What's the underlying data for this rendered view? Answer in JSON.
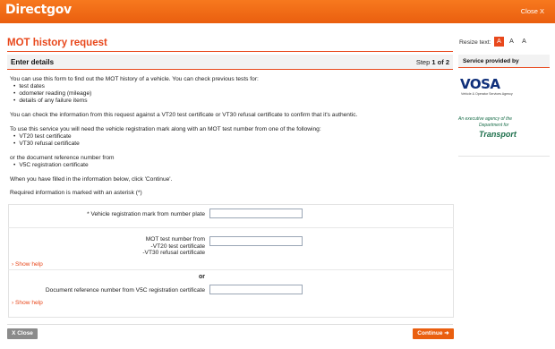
{
  "header": {
    "logo_text": "Directgov",
    "close_label": "Close X"
  },
  "page": {
    "title": "MOT history request",
    "section_title": "Enter details",
    "step_prefix": "Step",
    "step_current": "1",
    "step_of": "of",
    "step_total": "2"
  },
  "intro": {
    "p1": "You can use this form to find out the MOT history of a vehicle. You can check previous tests for:",
    "p1_items": [
      "test dates",
      "odometer reading (mileage)",
      "details of any failure items"
    ],
    "p2": "You can check the information from this request against a VT20 test certificate or VT30 refusal certificate to confirm that it's authentic.",
    "p3": "To use this service you will need the vehicle registration mark along with an MOT test number from one of the following:",
    "p3_items": [
      "VT20 test certificate",
      "VT30 refusal certificate"
    ],
    "p4": "or the document reference number from",
    "p4_items": [
      "V5C registration certificate"
    ],
    "p5": "When you have filled in the information below, click 'Continue'.",
    "p6": "Required information is marked with an asterisk (*)"
  },
  "form": {
    "registration_label": "* Vehicle registration mark from number plate",
    "registration_value": "",
    "mot_label_lines": [
      "MOT test number from",
      "-VT20 test certificate",
      "-VT30 refusal certificate"
    ],
    "mot_value": "",
    "show_help_1": "› Show help",
    "or_label": "or",
    "docref_label": "Document reference number from V5C registration certificate",
    "docref_value": "",
    "show_help_2": "› Show help"
  },
  "buttons": {
    "close": "X Close",
    "continue": "Continue ➜"
  },
  "sidebar": {
    "resize_label": "Resize text:",
    "resize_options": [
      "A",
      "A",
      "A"
    ],
    "provided_by": "Service provided by",
    "vosa_logo": "VOSA",
    "vosa_subtitle": "Vehicle & Operator Services Agency",
    "agency_line1": "An executive agency of the",
    "agency_line2": "Department for",
    "agency_line3": "Transport"
  },
  "colors": {
    "brand_orange": "#ea5f0f",
    "accent_red": "#e8481c",
    "dft_green": "#1b6e4a",
    "vosa_blue": "#0f2f7a"
  }
}
